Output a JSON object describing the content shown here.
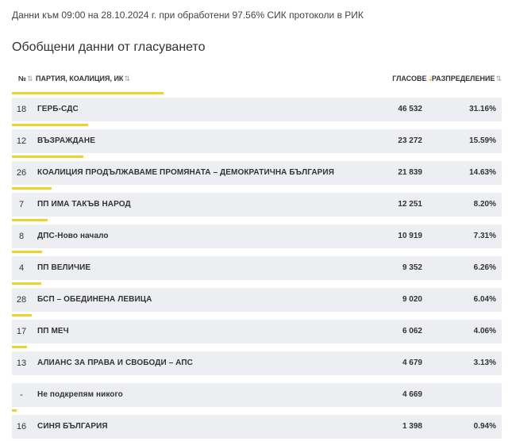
{
  "status_text": "Данни към 09:00 на 28.10.2024 г. при обработени 97.56% СИК протоколи в РИК",
  "heading": "Обобщени данни от гласуването",
  "columns": {
    "number": "№",
    "party": "ПАРТИЯ, КОАЛИЦИЯ, ИК",
    "votes": "ГЛАСОВЕ",
    "distribution": "РАЗПРЕДЕЛЕНИЕ"
  },
  "sort_icons": {
    "inactive": "⇅",
    "active": "⇣"
  },
  "accent_color": "#f2d02a",
  "rows": [
    {
      "number": "18",
      "party": "ГЕРБ-СДС",
      "votes": "46 532",
      "percent": "31.16%",
      "share": 31.16
    },
    {
      "number": "12",
      "party": "ВЪЗРАЖДАНЕ",
      "votes": "23 272",
      "percent": "15.59%",
      "share": 15.59
    },
    {
      "number": "26",
      "party": "КОАЛИЦИЯ ПРОДЪЛЖАВАМЕ ПРОМЯНАТА – ДЕМОКРАТИЧНА БЪЛГАРИЯ",
      "votes": "21 839",
      "percent": "14.63%",
      "share": 14.63
    },
    {
      "number": "7",
      "party": "ПП ИМА ТАКЪВ НАРОД",
      "votes": "12 251",
      "percent": "8.20%",
      "share": 8.2
    },
    {
      "number": "8",
      "party": "ДПС-Ново начало",
      "votes": "10 919",
      "percent": "7.31%",
      "share": 7.31
    },
    {
      "number": "4",
      "party": "ПП ВЕЛИЧИЕ",
      "votes": "9 352",
      "percent": "6.26%",
      "share": 6.26
    },
    {
      "number": "28",
      "party": "БСП – ОБЕДИНЕНА ЛЕВИЦА",
      "votes": "9 020",
      "percent": "6.04%",
      "share": 6.04
    },
    {
      "number": "17",
      "party": "ПП МЕЧ",
      "votes": "6 062",
      "percent": "4.06%",
      "share": 4.06
    },
    {
      "number": "13",
      "party": "АЛИАНС ЗА ПРАВА И СВОБОДИ – АПС",
      "votes": "4 679",
      "percent": "3.13%",
      "share": 3.13
    },
    {
      "number": "-",
      "party": "Не подкрепям никого",
      "votes": "4 669",
      "percent": "",
      "share": 0
    },
    {
      "number": "16",
      "party": "СИНЯ БЪЛГАРИЯ",
      "votes": "1 398",
      "percent": "0.94%",
      "share": 0.94
    }
  ]
}
